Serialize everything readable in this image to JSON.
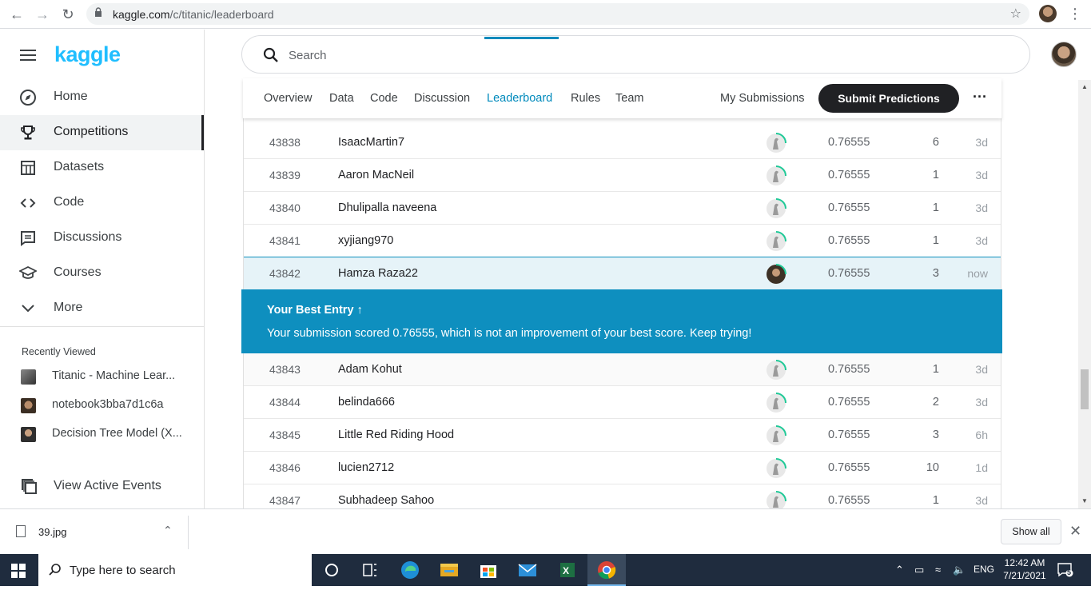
{
  "browser": {
    "url_host": "kaggle.com",
    "url_path": "/c/titanic/leaderboard"
  },
  "sidebar": {
    "logo": "kaggle",
    "items": [
      {
        "label": "Home",
        "icon": "compass-icon"
      },
      {
        "label": "Competitions",
        "icon": "trophy-icon",
        "active": true
      },
      {
        "label": "Datasets",
        "icon": "table-icon"
      },
      {
        "label": "Code",
        "icon": "code-icon"
      },
      {
        "label": "Discussions",
        "icon": "comments-icon"
      },
      {
        "label": "Courses",
        "icon": "graduation-cap-icon"
      },
      {
        "label": "More",
        "icon": "chevron-down-icon"
      }
    ],
    "recent_heading": "Recently Viewed",
    "recent": [
      {
        "label": "Titanic - Machine Lear..."
      },
      {
        "label": "notebook3bba7d1c6a"
      },
      {
        "label": "Decision Tree Model (X..."
      }
    ],
    "events_label": "View Active Events"
  },
  "search": {
    "placeholder": "Search"
  },
  "tabs": {
    "overview": "Overview",
    "data": "Data",
    "code": "Code",
    "discussion": "Discussion",
    "leaderboard": "Leaderboard",
    "rules": "Rules",
    "team": "Team",
    "my_submissions": "My Submissions",
    "submit": "Submit Predictions",
    "more": "···"
  },
  "leaderboard": {
    "rows_before": [
      {
        "rank": "43838",
        "team": "IsaacMartin7",
        "score": "0.76555",
        "entries": "6",
        "last": "3d"
      },
      {
        "rank": "43839",
        "team": "Aaron MacNeil",
        "score": "0.76555",
        "entries": "1",
        "last": "3d"
      },
      {
        "rank": "43840",
        "team": "Dhulipalla naveena",
        "score": "0.76555",
        "entries": "1",
        "last": "3d"
      },
      {
        "rank": "43841",
        "team": "xyjiang970",
        "score": "0.76555",
        "entries": "1",
        "last": "3d"
      }
    ],
    "me": {
      "rank": "43842",
      "team": "Hamza Raza22",
      "score": "0.76555",
      "entries": "3",
      "last": "now"
    },
    "banner": {
      "heading": "Your Best Entry ↑",
      "text": "Your submission scored 0.76555, which is not an improvement of your best score. Keep trying!"
    },
    "rows_after": [
      {
        "rank": "43843",
        "team": "Adam Kohut",
        "score": "0.76555",
        "entries": "1",
        "last": "3d"
      },
      {
        "rank": "43844",
        "team": "belinda666",
        "score": "0.76555",
        "entries": "2",
        "last": "3d"
      },
      {
        "rank": "43845",
        "team": "Little Red Riding Hood",
        "score": "0.76555",
        "entries": "3",
        "last": "6h"
      },
      {
        "rank": "43846",
        "team": "lucien2712",
        "score": "0.76555",
        "entries": "10",
        "last": "1d"
      },
      {
        "rank": "43847",
        "team": "Subhadeep Sahoo",
        "score": "0.76555",
        "entries": "1",
        "last": "3d"
      }
    ]
  },
  "downloads": {
    "file": "39.jpg",
    "show_all": "Show all"
  },
  "taskbar": {
    "search_placeholder": "Type here to search",
    "language": "ENG",
    "time": "12:42 AM",
    "date": "7/21/2021",
    "notifications": "5"
  },
  "colors": {
    "kaggle_blue": "#20beff",
    "accent": "#008abc",
    "banner": "#0e8fbf",
    "submit_bg": "#202124"
  }
}
